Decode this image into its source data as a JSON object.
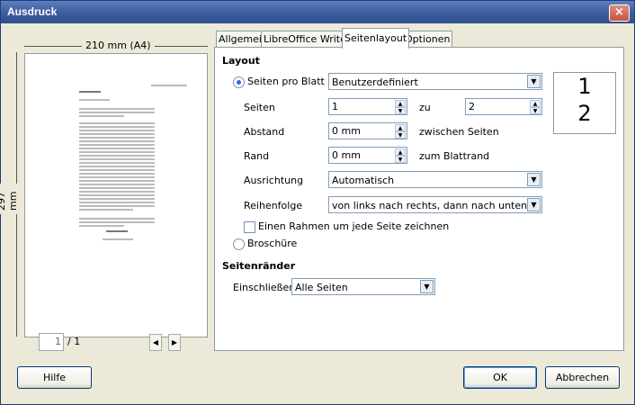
{
  "window": {
    "title": "Ausdruck",
    "close": "×"
  },
  "preview": {
    "width_label": "210 mm (A4)",
    "height_label": "297 mm",
    "page_current": "1",
    "page_total": "/ 1",
    "prev_icon": "◀",
    "next_icon": "▶"
  },
  "tabs": [
    "Allgemein",
    "LibreOffice Writer",
    "Seitenlayout",
    "Optionen"
  ],
  "layout": {
    "heading": "Layout",
    "pages_per_sheet_label": "Seiten pro Blatt",
    "pages_per_sheet_value": "Benutzerdefiniert",
    "seiten_label": "Seiten",
    "seiten_value": "1",
    "zu_label": "zu",
    "zu_value": "2",
    "abstand_label": "Abstand",
    "abstand_value": "0 mm",
    "abstand_suffix": "zwischen Seiten",
    "rand_label": "Rand",
    "rand_value": "0 mm",
    "rand_suffix": "zum Blattrand",
    "ausrichtung_label": "Ausrichtung",
    "ausrichtung_value": "Automatisch",
    "reihenfolge_label": "Reihenfolge",
    "reihenfolge_value": "von links nach rechts, dann nach unten",
    "frame_label": "Einen Rahmen um jede Seite zeichnen",
    "brochure_label": "Broschüre",
    "preview_page1": "1",
    "preview_page2": "2"
  },
  "margins": {
    "heading": "Seitenränder",
    "include_label": "Einschließen",
    "include_value": "Alle Seiten"
  },
  "buttons": {
    "help": "Hilfe",
    "ok": "OK",
    "cancel": "Abbrechen"
  }
}
